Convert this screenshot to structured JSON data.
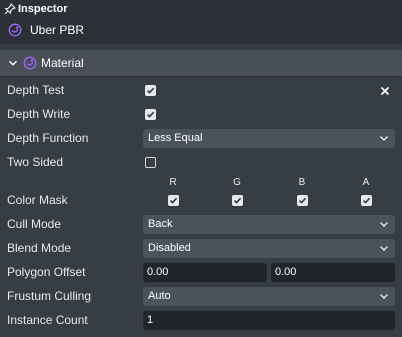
{
  "header": {
    "title": "Inspector",
    "asset_name": "Uber PBR"
  },
  "section": {
    "title": "Material"
  },
  "props": {
    "depth_test": {
      "label": "Depth Test",
      "checked": true
    },
    "depth_write": {
      "label": "Depth Write",
      "checked": true
    },
    "depth_function": {
      "label": "Depth Function",
      "value": "Less Equal"
    },
    "two_sided": {
      "label": "Two Sided",
      "checked": false
    },
    "color_mask": {
      "label": "Color Mask",
      "channels": [
        "R",
        "G",
        "B",
        "A"
      ],
      "checked": [
        true,
        true,
        true,
        true
      ]
    },
    "cull_mode": {
      "label": "Cull Mode",
      "value": "Back"
    },
    "blend_mode": {
      "label": "Blend Mode",
      "value": "Disabled"
    },
    "polygon_offset": {
      "label": "Polygon Offset",
      "factor": "0.00",
      "units": "0.00"
    },
    "frustum_culling": {
      "label": "Frustum Culling",
      "value": "Auto"
    },
    "instance_count": {
      "label": "Instance Count",
      "value": "1"
    }
  },
  "colors": {
    "accent": "#a064ff",
    "panel": "#363d43",
    "header": "#2b3136",
    "section": "#484f56",
    "field": "#4a535b",
    "input": "#20252a"
  }
}
